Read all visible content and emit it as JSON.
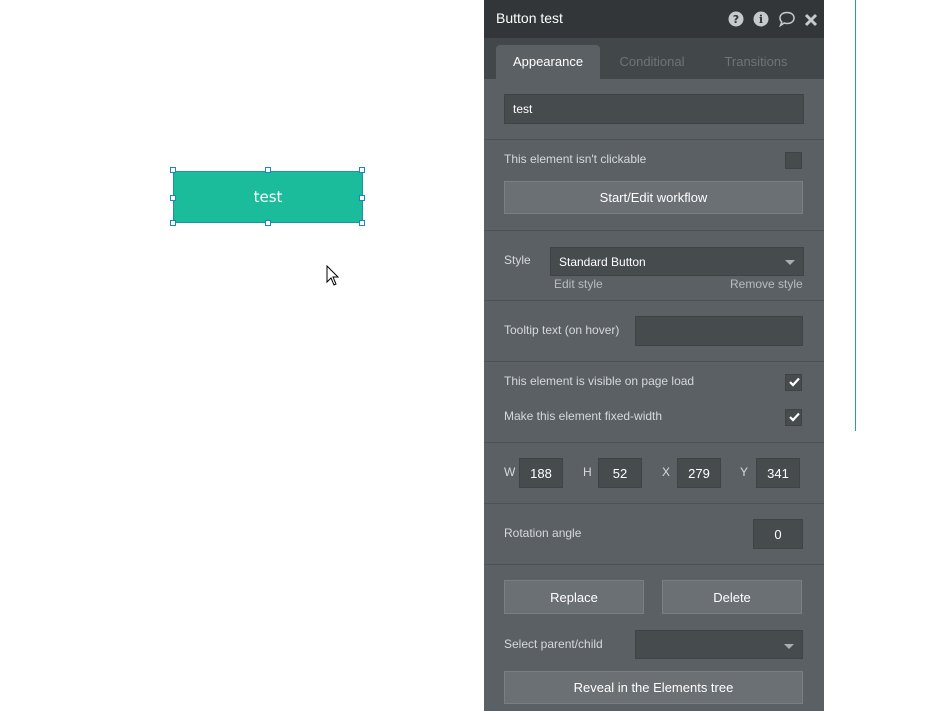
{
  "canvas": {
    "button_text": "test"
  },
  "panel": {
    "title": "Button test",
    "header_icons": [
      "help-icon",
      "info-icon",
      "comment-icon",
      "close-icon"
    ],
    "tabs": [
      {
        "label": "Appearance",
        "active": true
      },
      {
        "label": "Conditional",
        "active": false
      },
      {
        "label": "Transitions",
        "active": false
      }
    ],
    "text_value": "test",
    "not_clickable_label": "This element isn't clickable",
    "not_clickable_checked": false,
    "workflow_button": "Start/Edit workflow",
    "style_label": "Style",
    "style_value": "Standard Button",
    "edit_style": "Edit style",
    "remove_style": "Remove style",
    "tooltip_label": "Tooltip text (on hover)",
    "tooltip_value": "",
    "visible_label": "This element is visible on page load",
    "visible_checked": true,
    "fixed_width_label": "Make this element fixed-width",
    "fixed_width_checked": true,
    "dims": {
      "w_label": "W",
      "w_value": "188",
      "h_label": "H",
      "h_value": "52",
      "x_label": "X",
      "x_value": "279",
      "y_label": "Y",
      "y_value": "341"
    },
    "rotation_label": "Rotation angle",
    "rotation_value": "0",
    "replace_button": "Replace",
    "delete_button": "Delete",
    "parent_child_label": "Select parent/child",
    "parent_child_value": "",
    "reveal_button": "Reveal in the Elements tree"
  }
}
